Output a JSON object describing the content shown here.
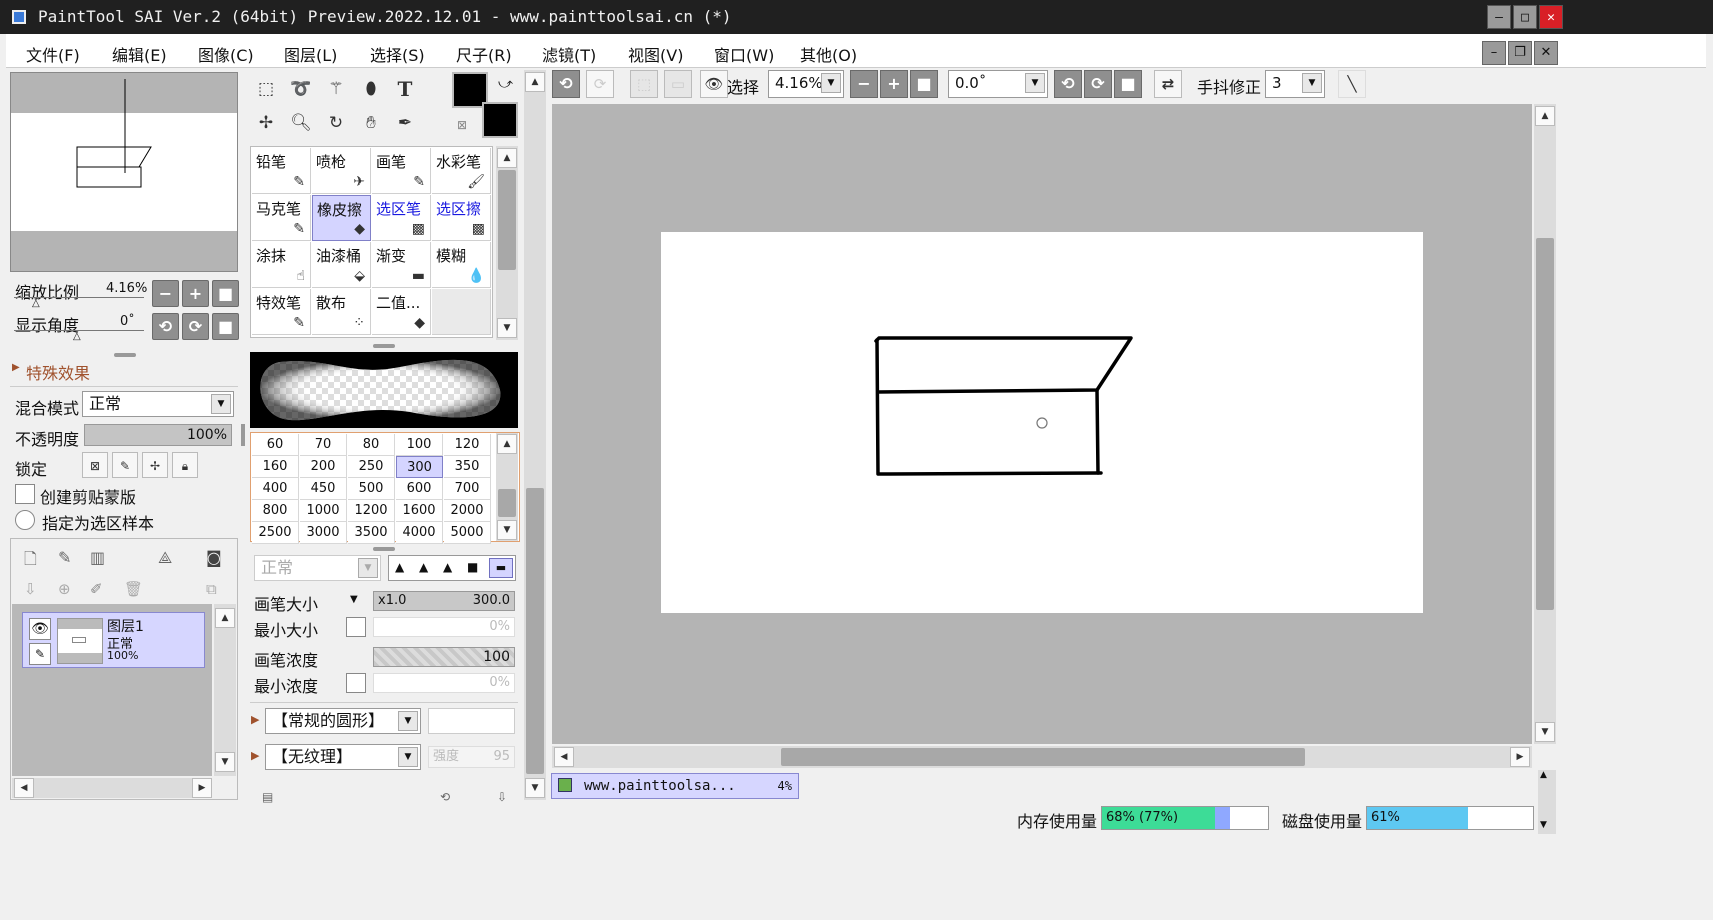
{
  "window": {
    "title": "PaintTool SAI Ver.2 (64bit) Preview.2022.12.01 - www.painttoolsai.cn (*)",
    "minimize": "–",
    "maximize": "□",
    "close": "✕"
  },
  "menu": [
    "文件(F)",
    "编辑(E)",
    "图像(C)",
    "图层(L)",
    "选择(S)",
    "尺子(R)",
    "滤镜(T)",
    "视图(V)",
    "窗口(W)",
    "其他(O)"
  ],
  "navigator": {
    "zoom_label": "缩放比例",
    "zoom_value": "4.16%",
    "angle_label": "显示角度",
    "angle_value": "0˚"
  },
  "effects": {
    "label": "特殊效果"
  },
  "layer_props": {
    "blend_label": "混合模式",
    "blend_value": "正常",
    "opacity_label": "不透明度",
    "opacity_value": "100%",
    "lock_label": "锁定",
    "clip_label": "创建剪贴蒙版",
    "sample_label": "指定为选区样本"
  },
  "layers": [
    {
      "name": "图层1",
      "mode": "正常",
      "opacity": "100%"
    }
  ],
  "brushes": [
    {
      "name": "铅笔",
      "icon": "✎"
    },
    {
      "name": "喷枪",
      "icon": "✈"
    },
    {
      "name": "画笔",
      "icon": "✎"
    },
    {
      "name": "水彩笔",
      "icon": "🖌"
    },
    {
      "name": "马克笔",
      "icon": "✎"
    },
    {
      "name": "橡皮擦",
      "icon": "◆"
    },
    {
      "name": "选区笔",
      "icon": "▩"
    },
    {
      "name": "选区擦",
      "icon": "▩"
    },
    {
      "name": "涂抹",
      "icon": "☝"
    },
    {
      "name": "油漆桶",
      "icon": "⬙"
    },
    {
      "name": "渐变",
      "icon": "▬"
    },
    {
      "name": "模糊",
      "icon": "💧"
    },
    {
      "name": "特效笔",
      "icon": "✎"
    },
    {
      "name": "散布",
      "icon": "⁘"
    },
    {
      "name": "二值...",
      "icon": "◆"
    },
    {
      "name": "",
      "icon": ""
    }
  ],
  "sizes": [
    "60",
    "70",
    "80",
    "100",
    "120",
    "160",
    "200",
    "250",
    "300",
    "350",
    "400",
    "450",
    "500",
    "600",
    "700",
    "800",
    "1000",
    "1200",
    "1600",
    "2000",
    "2500",
    "3000",
    "3500",
    "4000",
    "5000"
  ],
  "brush_settings": {
    "mode_value": "正常",
    "size_label": "画笔大小",
    "size_mult": "x1.0",
    "size_value": "300.0",
    "min_size_label": "最小大小",
    "min_size_value": "0%",
    "density_label": "画笔浓度",
    "density_value": "100",
    "min_density_label": "最小浓度",
    "min_density_value": "0%",
    "shape_value": "【常规的圆形】",
    "texture_value": "【无纹理】",
    "strength_label": "强度",
    "strength_value": "95"
  },
  "toolbar": {
    "select_label": "选择",
    "zoom_value": "4.16%",
    "angle_value": "0.0˚",
    "stabilizer_label": "手抖修正",
    "stabilizer_value": "3"
  },
  "document_tab": {
    "name": "www.painttoolsa...",
    "zoom": "4%"
  },
  "status": {
    "memory_label": "内存使用量",
    "memory_value": "68% (77%)",
    "memory_fill": 0.68,
    "memory_fill_peak": 0.77,
    "disk_label": "磁盘使用量",
    "disk_value": "61%",
    "disk_fill": 0.61
  },
  "colors": {
    "primary": "#000000",
    "secondary": "#000000",
    "memory_bar": "#3ddc97",
    "memory_peak": "#8fa8ff",
    "disk_bar": "#5ec8f2",
    "accent_select": "#d4d4ff"
  }
}
